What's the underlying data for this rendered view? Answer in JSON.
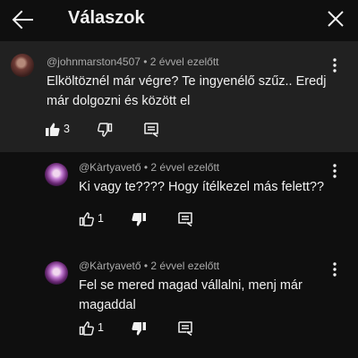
{
  "header": {
    "title": "Válaszok",
    "back_icon": "arrow-left-icon",
    "close_icon": "close-icon"
  },
  "comments": [
    {
      "author": "@johnmarston4507",
      "time": "2 évvel ezelőtt",
      "text": "Elköltöznél már végre? Te ingyenélő szűz.. Eredj már dolgozni és között el",
      "likes": "3",
      "liked": true,
      "disliked": false
    },
    {
      "author": "@Kàrtyavető",
      "time": "2 évvel ezelőtt",
      "text": "Ki vagy te???? Hogy ítélkezel más felett??",
      "likes": "1",
      "liked": false,
      "disliked": true
    },
    {
      "author": "@Kàrtyavető",
      "time": "2 évvel ezelőtt",
      "text": "Fel se mered magad vállalni,  menj már magaddal",
      "likes": "1",
      "liked": false,
      "disliked": true
    }
  ],
  "separator": " • ",
  "colors": {
    "background": "#0f0f0f",
    "highlight": "#212121",
    "text": "#f1f1f1",
    "secondary": "#aaaaaa"
  }
}
